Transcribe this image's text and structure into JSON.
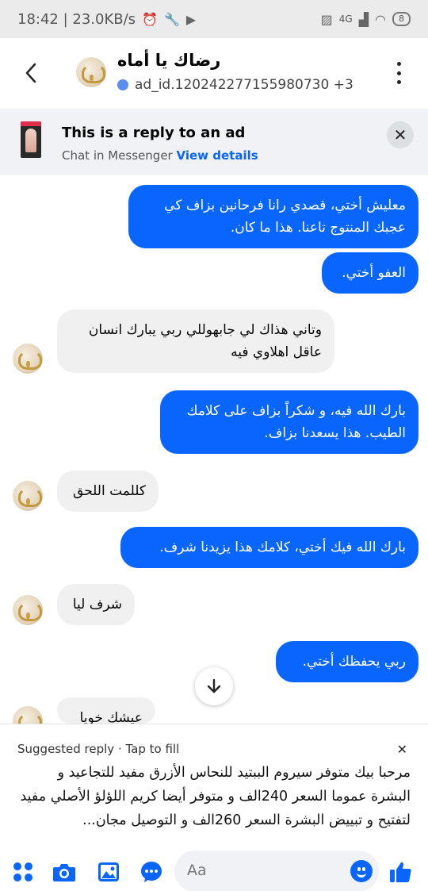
{
  "status_bar": {
    "time_speed": "18:42 | 23.0KB/s",
    "network": "4G",
    "battery": "8"
  },
  "header": {
    "title": "رضاك يا أماه",
    "subtitle": "ad_id.120242277155980730 +3"
  },
  "ad_banner": {
    "title": "This is a reply to an ad",
    "subtitle": "Chat in Messenger",
    "link": "View details"
  },
  "messages": [
    {
      "direction": "out",
      "text": "معليش أختي، قصدي رانا فرحانين بزاف كي عجبك المنتوج تاعنا. هذا ما كان."
    },
    {
      "direction": "out",
      "text": "العفو أختي."
    },
    {
      "direction": "in",
      "text": "وتاني هذاك لي جابهوللي ربي يبارك انسان عاقل اهلاوي فيه"
    },
    {
      "direction": "out",
      "text": "بارك الله فيه، و شكراً بزاف على كلامك الطيب. هذا يسعدنا بزاف."
    },
    {
      "direction": "in",
      "text": "كللمت اللحق"
    },
    {
      "direction": "out",
      "text": "بارك الله فيك أختي، كلامك هذا يزيدنا شرف."
    },
    {
      "direction": "in",
      "text": "شرف ليا"
    },
    {
      "direction": "out",
      "text": "ربي يحفظك أختي."
    },
    {
      "direction": "in",
      "text": "عيشك خويا"
    }
  ],
  "suggested_reply": {
    "label": "Suggested reply",
    "action": "Tap to fill",
    "text": "مرحبا بيك متوفر سيروم الببتيد للنحاس الأزرق مفيد للتجاعيد و البشرة عموما السعر 240الف و متوفر أيضا كريم اللؤلؤ الأصلي مفيد لتفتيح و تبييض البشرة السعر 260الف و التوصيل مجان..."
  },
  "composer": {
    "placeholder": "Aa"
  },
  "colors": {
    "accent": "#0866ff",
    "incoming_bubble": "#f0f0f0",
    "banner_bg": "#f0f2f5"
  }
}
